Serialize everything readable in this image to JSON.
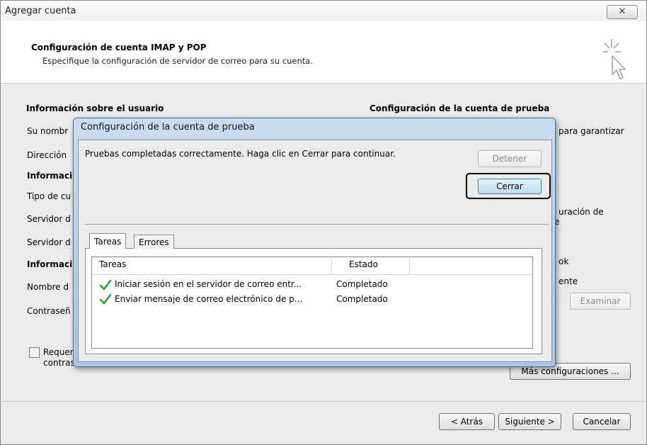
{
  "window": {
    "title": "Agregar cuenta",
    "close_glyph": "✕"
  },
  "header": {
    "title": "Configuración de cuenta IMAP y POP",
    "subtitle": "Especifique la configuración de servidor de correo para su cuenta."
  },
  "left": {
    "section_user": "Información sobre el usuario",
    "user_name": "Su nombr",
    "email": "Dirección",
    "section_server": "Informaci",
    "account_type": "Tipo de cu",
    "incoming": "Servidor d",
    "outgoing": "Servidor d",
    "section_login": "Informaci",
    "username": "Nombre d",
    "password": "Contraseñ",
    "spa_line1": "Requer",
    "spa_line2": "contras"
  },
  "right": {
    "section_test": "Configuración de la cuenta de prueba",
    "guarantee": "para garantizar",
    "config": "uración de",
    "config2": "e",
    "ok": "ok",
    "ente": "ente",
    "browse": "Examinar",
    "more": "Más configuraciones ..."
  },
  "footer": {
    "back": "< Atrás",
    "next": "Siguiente >",
    "cancel": "Cancelar"
  },
  "dialog": {
    "title": "Configuración de la cuenta de prueba",
    "message": "Pruebas completadas correctamente. Haga clic en Cerrar para continuar.",
    "stop": "Detener",
    "close": "Cerrar",
    "tabs": [
      "Tareas",
      "Errores"
    ],
    "columns": {
      "task": "Tareas",
      "state": "Estado"
    },
    "rows": [
      {
        "task": "Iniciar sesión en el servidor de correo entr...",
        "state": "Completado"
      },
      {
        "task": "Enviar mensaje de correo electrónico de p...",
        "state": "Completado"
      }
    ]
  },
  "colors": {
    "check_green": "#2e9a2e",
    "highlight_border": "#000000",
    "dialog_frame": "#b6cfeb"
  }
}
